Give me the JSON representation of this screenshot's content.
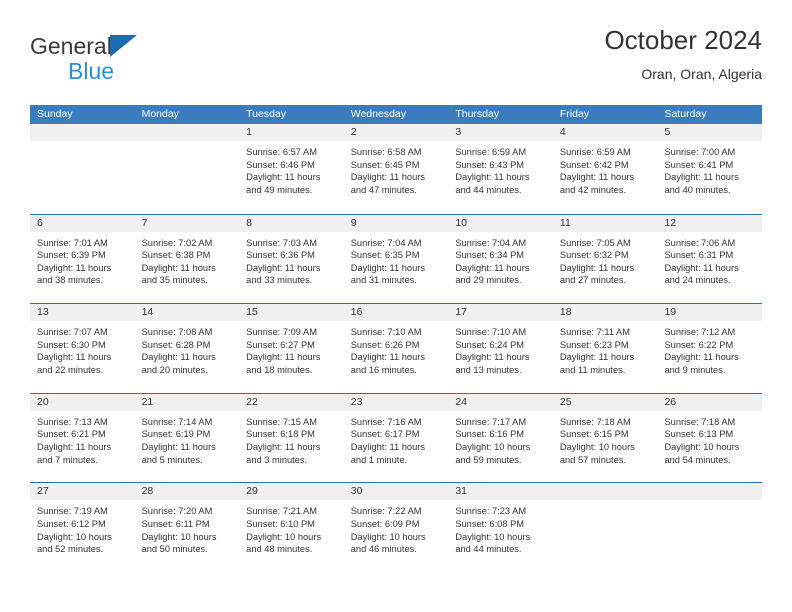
{
  "brand": {
    "name_top": "General",
    "name_bottom": "Blue",
    "triangle_color": "#1b6cb5",
    "blue_text_color": "#2a8fd4"
  },
  "header": {
    "title": "October 2024",
    "subtitle": "Oran, Oran, Algeria"
  },
  "colors": {
    "header_row_bg": "#3a7cbe",
    "week_divider": "#2f6fae",
    "daynum_band_bg": "#f0f0f0",
    "text": "#333333"
  },
  "weekdays": [
    "Sunday",
    "Monday",
    "Tuesday",
    "Wednesday",
    "Thursday",
    "Friday",
    "Saturday"
  ],
  "weeks": [
    [
      {
        "date": "",
        "lines": []
      },
      {
        "date": "",
        "lines": []
      },
      {
        "date": "1",
        "lines": [
          "Sunrise: 6:57 AM",
          "Sunset: 6:46 PM",
          "Daylight: 11 hours",
          "and 49 minutes."
        ]
      },
      {
        "date": "2",
        "lines": [
          "Sunrise: 6:58 AM",
          "Sunset: 6:45 PM",
          "Daylight: 11 hours",
          "and 47 minutes."
        ]
      },
      {
        "date": "3",
        "lines": [
          "Sunrise: 6:59 AM",
          "Sunset: 6:43 PM",
          "Daylight: 11 hours",
          "and 44 minutes."
        ]
      },
      {
        "date": "4",
        "lines": [
          "Sunrise: 6:59 AM",
          "Sunset: 6:42 PM",
          "Daylight: 11 hours",
          "and 42 minutes."
        ]
      },
      {
        "date": "5",
        "lines": [
          "Sunrise: 7:00 AM",
          "Sunset: 6:41 PM",
          "Daylight: 11 hours",
          "and 40 minutes."
        ]
      }
    ],
    [
      {
        "date": "6",
        "lines": [
          "Sunrise: 7:01 AM",
          "Sunset: 6:39 PM",
          "Daylight: 11 hours",
          "and 38 minutes."
        ]
      },
      {
        "date": "7",
        "lines": [
          "Sunrise: 7:02 AM",
          "Sunset: 6:38 PM",
          "Daylight: 11 hours",
          "and 35 minutes."
        ]
      },
      {
        "date": "8",
        "lines": [
          "Sunrise: 7:03 AM",
          "Sunset: 6:36 PM",
          "Daylight: 11 hours",
          "and 33 minutes."
        ]
      },
      {
        "date": "9",
        "lines": [
          "Sunrise: 7:04 AM",
          "Sunset: 6:35 PM",
          "Daylight: 11 hours",
          "and 31 minutes."
        ]
      },
      {
        "date": "10",
        "lines": [
          "Sunrise: 7:04 AM",
          "Sunset: 6:34 PM",
          "Daylight: 11 hours",
          "and 29 minutes."
        ]
      },
      {
        "date": "11",
        "lines": [
          "Sunrise: 7:05 AM",
          "Sunset: 6:32 PM",
          "Daylight: 11 hours",
          "and 27 minutes."
        ]
      },
      {
        "date": "12",
        "lines": [
          "Sunrise: 7:06 AM",
          "Sunset: 6:31 PM",
          "Daylight: 11 hours",
          "and 24 minutes."
        ]
      }
    ],
    [
      {
        "date": "13",
        "lines": [
          "Sunrise: 7:07 AM",
          "Sunset: 6:30 PM",
          "Daylight: 11 hours",
          "and 22 minutes."
        ]
      },
      {
        "date": "14",
        "lines": [
          "Sunrise: 7:08 AM",
          "Sunset: 6:28 PM",
          "Daylight: 11 hours",
          "and 20 minutes."
        ]
      },
      {
        "date": "15",
        "lines": [
          "Sunrise: 7:09 AM",
          "Sunset: 6:27 PM",
          "Daylight: 11 hours",
          "and 18 minutes."
        ]
      },
      {
        "date": "16",
        "lines": [
          "Sunrise: 7:10 AM",
          "Sunset: 6:26 PM",
          "Daylight: 11 hours",
          "and 16 minutes."
        ]
      },
      {
        "date": "17",
        "lines": [
          "Sunrise: 7:10 AM",
          "Sunset: 6:24 PM",
          "Daylight: 11 hours",
          "and 13 minutes."
        ]
      },
      {
        "date": "18",
        "lines": [
          "Sunrise: 7:11 AM",
          "Sunset: 6:23 PM",
          "Daylight: 11 hours",
          "and 11 minutes."
        ]
      },
      {
        "date": "19",
        "lines": [
          "Sunrise: 7:12 AM",
          "Sunset: 6:22 PM",
          "Daylight: 11 hours",
          "and 9 minutes."
        ]
      }
    ],
    [
      {
        "date": "20",
        "lines": [
          "Sunrise: 7:13 AM",
          "Sunset: 6:21 PM",
          "Daylight: 11 hours",
          "and 7 minutes."
        ]
      },
      {
        "date": "21",
        "lines": [
          "Sunrise: 7:14 AM",
          "Sunset: 6:19 PM",
          "Daylight: 11 hours",
          "and 5 minutes."
        ]
      },
      {
        "date": "22",
        "lines": [
          "Sunrise: 7:15 AM",
          "Sunset: 6:18 PM",
          "Daylight: 11 hours",
          "and 3 minutes."
        ]
      },
      {
        "date": "23",
        "lines": [
          "Sunrise: 7:16 AM",
          "Sunset: 6:17 PM",
          "Daylight: 11 hours",
          "and 1 minute."
        ]
      },
      {
        "date": "24",
        "lines": [
          "Sunrise: 7:17 AM",
          "Sunset: 6:16 PM",
          "Daylight: 10 hours",
          "and 59 minutes."
        ]
      },
      {
        "date": "25",
        "lines": [
          "Sunrise: 7:18 AM",
          "Sunset: 6:15 PM",
          "Daylight: 10 hours",
          "and 57 minutes."
        ]
      },
      {
        "date": "26",
        "lines": [
          "Sunrise: 7:18 AM",
          "Sunset: 6:13 PM",
          "Daylight: 10 hours",
          "and 54 minutes."
        ]
      }
    ],
    [
      {
        "date": "27",
        "lines": [
          "Sunrise: 7:19 AM",
          "Sunset: 6:12 PM",
          "Daylight: 10 hours",
          "and 52 minutes."
        ]
      },
      {
        "date": "28",
        "lines": [
          "Sunrise: 7:20 AM",
          "Sunset: 6:11 PM",
          "Daylight: 10 hours",
          "and 50 minutes."
        ]
      },
      {
        "date": "29",
        "lines": [
          "Sunrise: 7:21 AM",
          "Sunset: 6:10 PM",
          "Daylight: 10 hours",
          "and 48 minutes."
        ]
      },
      {
        "date": "30",
        "lines": [
          "Sunrise: 7:22 AM",
          "Sunset: 6:09 PM",
          "Daylight: 10 hours",
          "and 46 minutes."
        ]
      },
      {
        "date": "31",
        "lines": [
          "Sunrise: 7:23 AM",
          "Sunset: 6:08 PM",
          "Daylight: 10 hours",
          "and 44 minutes."
        ]
      },
      {
        "date": "",
        "lines": []
      },
      {
        "date": "",
        "lines": []
      }
    ]
  ]
}
